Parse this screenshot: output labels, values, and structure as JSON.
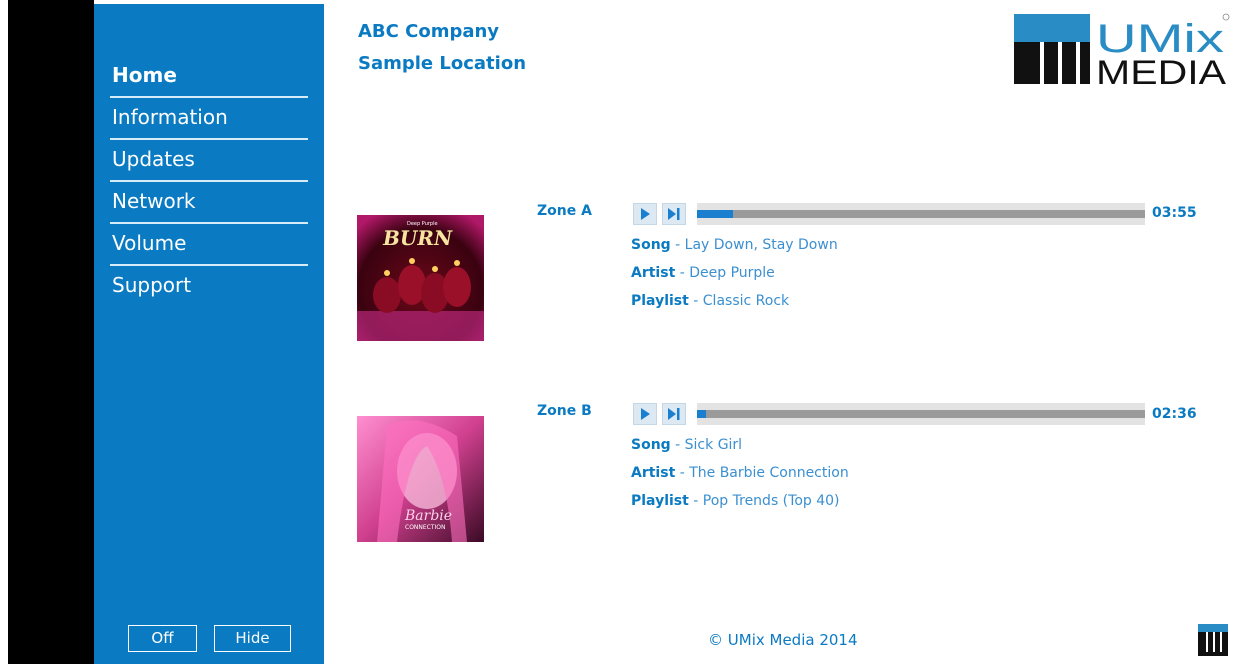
{
  "header": {
    "company": "ABC Company",
    "location": "Sample Location",
    "logo_text_top": "UMix",
    "logo_text_bottom": "MEDIA"
  },
  "sidebar": {
    "items": [
      {
        "label": "Home",
        "active": true
      },
      {
        "label": "Information"
      },
      {
        "label": "Updates"
      },
      {
        "label": "Network"
      },
      {
        "label": "Volume"
      },
      {
        "label": "Support"
      }
    ],
    "off_label": "Off",
    "hide_label": "Hide"
  },
  "zones": [
    {
      "label": "Zone A",
      "time": "03:55",
      "progress": 0.08,
      "song_label": "Song",
      "song": "Lay Down, Stay Down",
      "artist_label": "Artist",
      "artist": "Deep Purple",
      "playlist_label": "Playlist",
      "playlist": "Classic Rock",
      "album_band": "Deep Purple",
      "album_title": "BURN"
    },
    {
      "label": "Zone B",
      "time": "02:36",
      "progress": 0.02,
      "song_label": "Song",
      "song": "Sick Girl",
      "artist_label": "Artist",
      "artist": "The Barbie Connection",
      "playlist_label": "Playlist",
      "playlist": "Pop Trends (Top 40)",
      "album_title": "Barbie",
      "album_sub": "CONNECTION"
    }
  ],
  "footer": {
    "copyright": "© UMix Media 2014"
  },
  "colors": {
    "brand_blue": "#0a7ac2",
    "progress_fill": "#1a7fcf"
  }
}
